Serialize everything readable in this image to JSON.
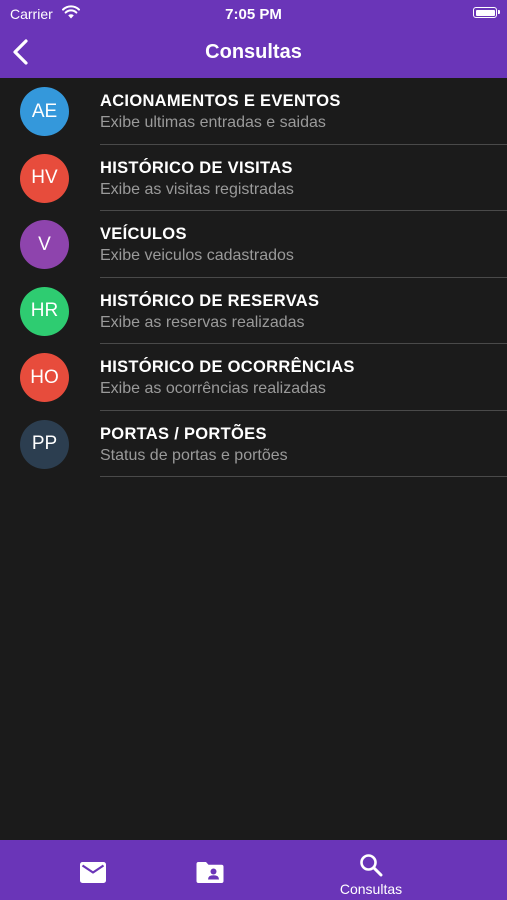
{
  "status_bar": {
    "carrier": "Carrier",
    "time": "7:05 PM",
    "battery_level": 1.0
  },
  "nav": {
    "title": "Consultas",
    "back_icon": "chevron-left-icon"
  },
  "items": [
    {
      "initials": "AE",
      "color": "#3498db",
      "title": "ACIONAMENTOS E EVENTOS",
      "subtitle": "Exibe ultimas entradas e saidas"
    },
    {
      "initials": "HV",
      "color": "#e74c3c",
      "title": "HISTÓRICO DE VISITAS",
      "subtitle": "Exibe as visitas registradas"
    },
    {
      "initials": "V",
      "color": "#8e44ad",
      "title": "VEÍCULOS",
      "subtitle": "Exibe veiculos cadastrados"
    },
    {
      "initials": "HR",
      "color": "#2ecc71",
      "title": "HISTÓRICO DE RESERVAS",
      "subtitle": "Exibe as reservas realizadas"
    },
    {
      "initials": "HO",
      "color": "#e74c3c",
      "title": "HISTÓRICO DE OCORRÊNCIAS",
      "subtitle": "Exibe as ocorrências realizadas"
    },
    {
      "initials": "PP",
      "color": "#2c3e50",
      "title": "PORTAS / PORTÕES",
      "subtitle": "Status de portas e portões"
    }
  ],
  "tab_bar": {
    "tabs": [
      {
        "icon": "mail-icon",
        "label": ""
      },
      {
        "icon": "contact-folder-icon",
        "label": ""
      },
      {
        "icon": "search-icon",
        "label": "Consultas",
        "selected": true
      }
    ]
  },
  "colors": {
    "header": "#6a35b8",
    "background": "#1b1b1b",
    "subtitle_text": "#9a9a9a",
    "divider": "#4a4a4a"
  }
}
